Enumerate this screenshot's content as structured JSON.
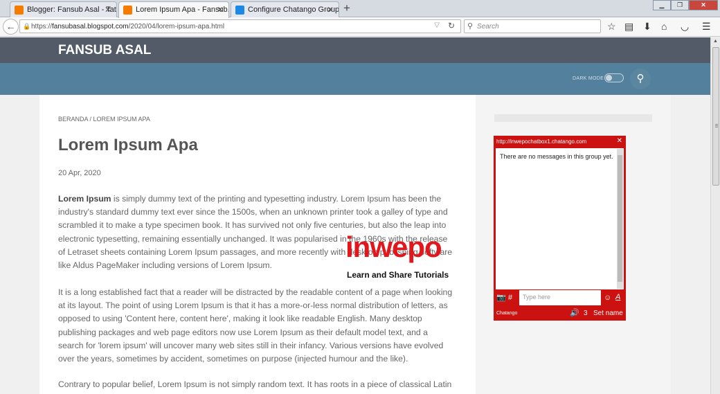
{
  "browser": {
    "tabs": [
      {
        "title": "Blogger: Fansub Asal - Tat...",
        "favicon_color": "#f57c00"
      },
      {
        "title": "Lorem Ipsum Apa - Fansub...",
        "favicon_color": "#f57c00"
      },
      {
        "title": "Configure Chatango Group",
        "favicon_color": "#1e88e5"
      }
    ],
    "active_tab": 1,
    "new_tab": "+",
    "url_prefix": "https://",
    "url_host": "fansubasal.blogspot.com",
    "url_path": "/2020/04/lorem-ipsum-apa.html",
    "search_placeholder": "Search",
    "icons": [
      "back-icon",
      "lock-icon",
      "reload-icon",
      "search-icon",
      "bookmark-star-icon",
      "reading-list-icon",
      "download-icon",
      "home-icon",
      "pocket-icon",
      "menu-icon"
    ]
  },
  "site": {
    "brand": "FANSUB ASAL",
    "dark_mode_label": "DARK MODE",
    "dark_mode_on": false,
    "colors": {
      "topbar": "#525b67",
      "navbar": "#53809d"
    }
  },
  "post": {
    "breadcrumb": "BERANDA / LOREM IPSUM APA",
    "title": "Lorem Ipsum Apa",
    "date": "20 Apr, 2020",
    "p1_lead": "Lorem Ipsum",
    "p1_rest": " is simply dummy text of the printing and typesetting industry. Lorem Ipsum has been the industry's standard dummy text ever since the 1500s, when an unknown printer took a galley of type and scrambled it to make a type specimen book. It has survived not only five centuries, but also the leap into electronic typesetting, remaining essentially unchanged. It was popularised in the 1960s with the release of Letraset sheets containing Lorem Ipsum passages, and more recently with desktop publishing software like Aldus PageMaker including versions of Lorem Ipsum.",
    "p2": "It is a long established fact that a reader will be distracted by the readable content of a page when looking at its layout. The point of using Lorem Ipsum is that it has a more-or-less normal distribution of letters, as opposed to using 'Content here, content here', making it look like readable English. Many desktop publishing packages and web page editors now use Lorem Ipsum as their default model text, and a search for 'lorem ipsum' will uncover many web sites still in their infancy. Various versions have evolved over the years, sometimes by accident, sometimes on purpose (injected humour and the like).",
    "p3": "Contrary to popular belief, Lorem Ipsum is not simply random text. It has roots in a piece of classical Latin"
  },
  "watermark": {
    "logo": "inwepo",
    "tagline": "Learn and Share Tutorials"
  },
  "chatbox": {
    "url": "http://inwepochatbox1.chatango.com",
    "close": "✕",
    "empty_message": "There are no messages in this group yet.",
    "input_placeholder": "Type here",
    "hash": "#",
    "font_button": "A",
    "brand": "Chatango",
    "user_count": "3",
    "set_name": "Set name",
    "color": "#cc1111"
  }
}
